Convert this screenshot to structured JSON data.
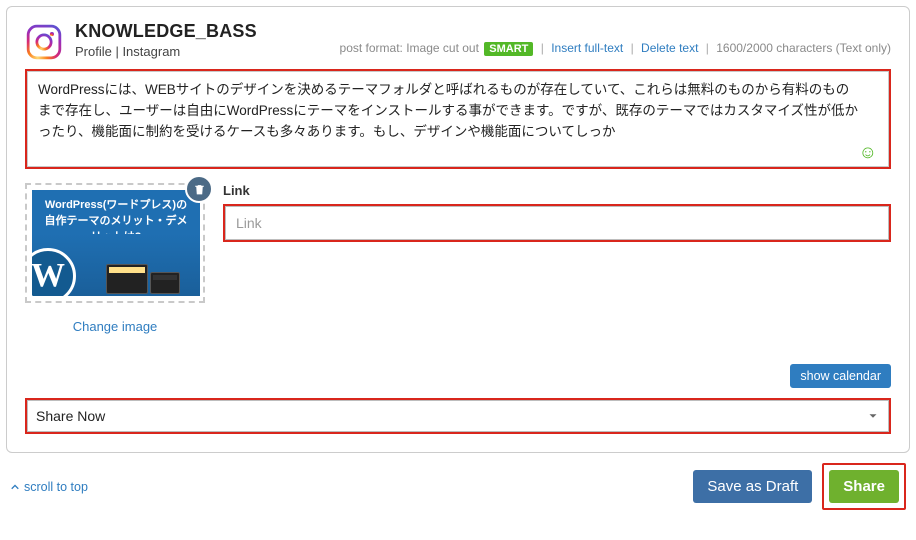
{
  "profile": {
    "name": "KNOWLEDGE_BASS",
    "subtitle": "Profile | Instagram"
  },
  "toolbar": {
    "post_format_label": "post format: Image cut out",
    "smart_badge": "SMART",
    "insert_full_text": "Insert full-text",
    "delete_text": "Delete text",
    "char_counter": "1600/2000 characters (Text only)"
  },
  "content": {
    "text": "WordPressには、WEBサイトのデザインを決めるテーマフォルダと呼ばれるものが存在していて、これらは無料のものから有料のものまで存在し、ユーザーは自由にWordPressにテーマをインストールする事ができます。ですが、既存のテーマではカスタマイズ性が低かったり、機能面に制約を受けるケースも多々あります。もし、デザインや機能面についてしっか"
  },
  "image": {
    "thumb_line1": "WordPress(ワードプレス)の",
    "thumb_line2": "自作テーマのメリット・デメリットは?",
    "change_label": "Change image"
  },
  "link": {
    "label": "Link",
    "placeholder": "Link",
    "value": ""
  },
  "calendar": {
    "button": "show calendar"
  },
  "schedule": {
    "selected": "Share Now"
  },
  "footer": {
    "scroll_top": "scroll to top",
    "save_draft": "Save as Draft",
    "share": "Share"
  }
}
